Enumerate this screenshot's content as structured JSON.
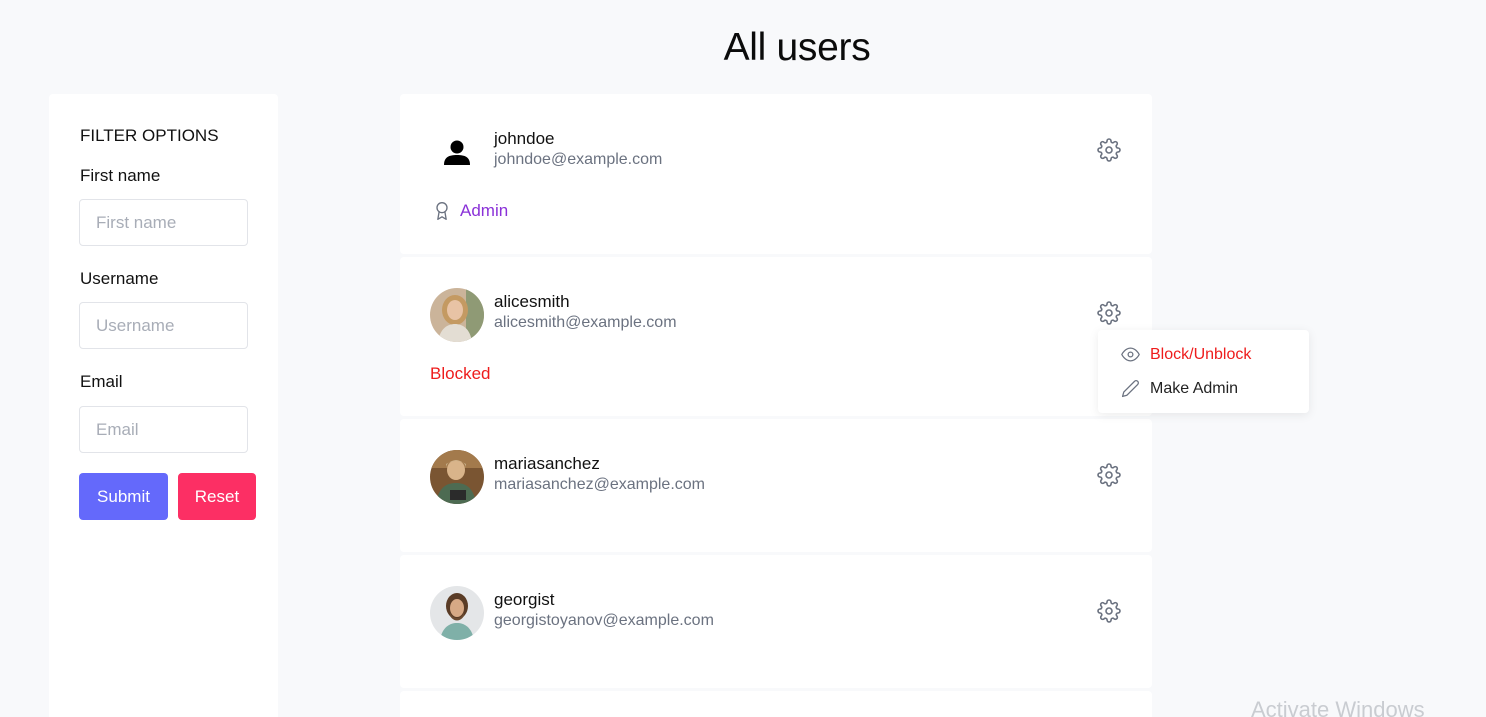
{
  "page": {
    "title": "All users"
  },
  "filter": {
    "heading": "FILTER OPTIONS",
    "first_name": {
      "label": "First name",
      "placeholder": "First name",
      "value": ""
    },
    "username": {
      "label": "Username",
      "placeholder": "Username",
      "value": ""
    },
    "email": {
      "label": "Email",
      "placeholder": "Email",
      "value": ""
    },
    "submit_label": "Submit",
    "reset_label": "Reset"
  },
  "users": [
    {
      "username": "johndoe",
      "email": "johndoe@example.com",
      "avatar": "person-icon",
      "role": "Admin",
      "status": ""
    },
    {
      "username": "alicesmith",
      "email": "alicesmith@example.com",
      "avatar": "photo",
      "role": "",
      "status": "Blocked"
    },
    {
      "username": "mariasanchez",
      "email": "mariasanchez@example.com",
      "avatar": "photo",
      "role": "",
      "status": ""
    },
    {
      "username": "georgist",
      "email": "georgistoyanov@example.com",
      "avatar": "photo",
      "role": "",
      "status": ""
    }
  ],
  "dropdown": {
    "block_label": "Block/Unblock",
    "admin_label": "Make Admin"
  },
  "watermark": "Activate Windows",
  "colors": {
    "accent_primary": "#6469fb",
    "accent_reset": "#fc2f64",
    "admin_purple": "#8a31d8",
    "blocked_red": "#ee1c1c",
    "page_bg": "#f8f9fb"
  }
}
